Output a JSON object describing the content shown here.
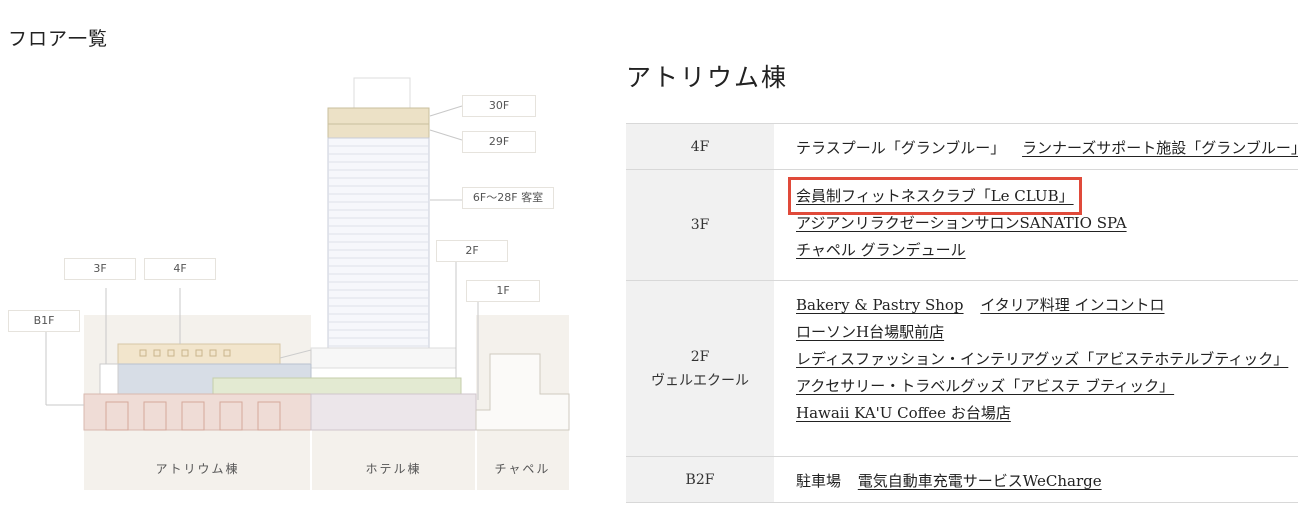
{
  "page": {
    "title": "フロア一覧"
  },
  "diagram": {
    "floor_tags": [
      "30F",
      "29F",
      "6F〜28F 客室",
      "2F",
      "1F",
      "3F",
      "4F",
      "B1F"
    ],
    "zones": [
      "アトリウム棟",
      "ホテル棟",
      "チャペル"
    ]
  },
  "section": {
    "title": "アトリウム棟"
  },
  "floors": [
    {
      "floor": "4F",
      "sub": "",
      "lines": [
        [
          "テラスプール「グランブルー」",
          "ランナーズサポート施設「グランブルー」"
        ]
      ]
    },
    {
      "floor": "3F",
      "sub": "",
      "lines": [
        [
          "会員制フィットネスクラブ「Le CLUB」"
        ],
        [
          "アジアンリラクゼーションサロンSANATIO SPA"
        ],
        [
          "チャペル グランデュール"
        ]
      ]
    },
    {
      "floor": "2F",
      "sub": "ヴェルエクール",
      "lines": [
        [
          "Bakery & Pastry Shop",
          "イタリア料理 インコントロ"
        ],
        [
          "ローソンH台場駅前店"
        ],
        [
          "レディスファッション・インテリアグッズ「アビステホテルブティック」"
        ],
        [
          "アクセサリー・トラベルグッズ「アビステ ブティック」"
        ],
        [
          "Hawaii KA'U Coffee お台場店"
        ]
      ]
    },
    {
      "floor": "B2F",
      "sub": "",
      "lines": [
        [
          "駐車場",
          "電気自動車充電サービスWeCharge"
        ]
      ]
    }
  ],
  "highlight": {
    "floor_index": 1,
    "line_index": 0,
    "item_index": 0,
    "color": "#e04a3a"
  },
  "colors": {
    "floor_4f": "#f2e5cc",
    "floor_3f": "#d7dde6",
    "floor_b1f": "#efdcd6",
    "floor_2f": "#e3ead2",
    "zone_bg": "#f2efea",
    "accent": "#e04a3a"
  }
}
